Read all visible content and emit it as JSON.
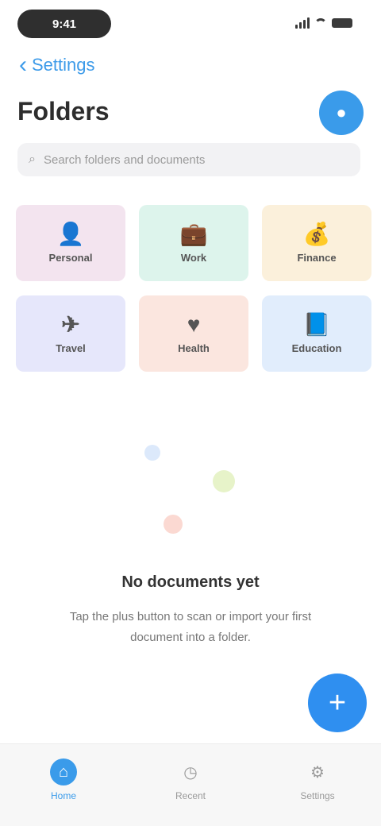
{
  "status_bar": {
    "time": "9:41"
  },
  "nav": {
    "back_label": "Settings",
    "back_icon": "chevron-left-icon"
  },
  "header": {
    "title": "Folders",
    "profile_icon": "user-icon"
  },
  "search": {
    "placeholder": "Search folders and documents"
  },
  "categories": [
    {
      "label": "Personal",
      "icon": "user-icon",
      "glyph": "👤",
      "color": "#f3e4ef"
    },
    {
      "label": "Work",
      "icon": "briefcase-icon",
      "glyph": "💼",
      "color": "#ddf4ec"
    },
    {
      "label": "Finance",
      "icon": "wallet-icon",
      "glyph": "💰",
      "color": "#fbf0db"
    },
    {
      "label": "Travel",
      "icon": "plane-icon",
      "glyph": "✈",
      "color": "#e6e7fb"
    },
    {
      "label": "Health",
      "icon": "heart-icon",
      "glyph": "♥",
      "color": "#fbe6df"
    },
    {
      "label": "Education",
      "icon": "book-icon",
      "glyph": "📘",
      "color": "#e1edfc"
    }
  ],
  "empty_state": {
    "title": "No documents yet",
    "description": "Tap the plus button to scan or import your first document into a folder."
  },
  "fab": {
    "icon": "plus-icon",
    "glyph": "+"
  },
  "tabs": [
    {
      "label": "Home",
      "icon": "home-icon",
      "glyph": "⌂",
      "active": true
    },
    {
      "label": "Recent",
      "icon": "clock-icon",
      "glyph": "◷",
      "active": false
    },
    {
      "label": "Settings",
      "icon": "gear-icon",
      "glyph": "⚙",
      "active": false
    }
  ],
  "colors": {
    "accent": "#3a9bea",
    "fab": "#2f8ff0"
  }
}
